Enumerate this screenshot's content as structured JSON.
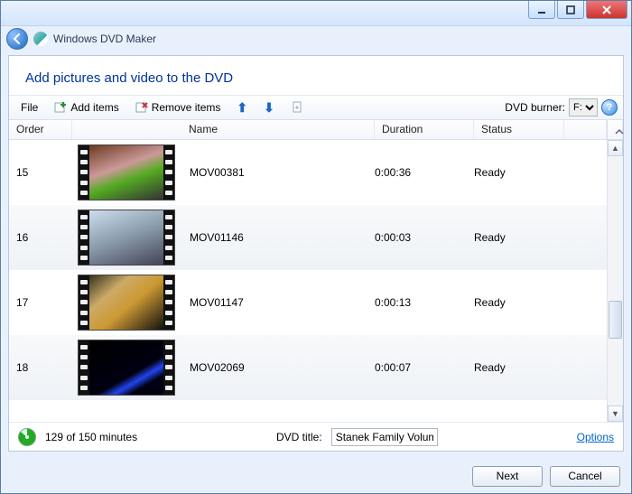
{
  "app": {
    "title": "Windows DVD Maker"
  },
  "heading": "Add pictures and video to the DVD",
  "toolbar": {
    "file": "File",
    "add": "Add items",
    "remove": "Remove items",
    "burner_label": "DVD burner:",
    "burner_value": "F:"
  },
  "columns": {
    "order": "Order",
    "name": "Name",
    "duration": "Duration",
    "status": "Status"
  },
  "rows": [
    {
      "order": "15",
      "name": "MOV00381",
      "duration": "0:00:36",
      "status": "Ready"
    },
    {
      "order": "16",
      "name": "MOV01146",
      "duration": "0:00:03",
      "status": "Ready"
    },
    {
      "order": "17",
      "name": "MOV01147",
      "duration": "0:00:13",
      "status": "Ready"
    },
    {
      "order": "18",
      "name": "MOV02069",
      "duration": "0:00:07",
      "status": "Ready"
    }
  ],
  "footer": {
    "minutes": "129 of 150 minutes",
    "dvd_title_label": "DVD title:",
    "dvd_title_value": "Stanek Family Volum",
    "options": "Options"
  },
  "buttons": {
    "next": "Next",
    "cancel": "Cancel"
  }
}
